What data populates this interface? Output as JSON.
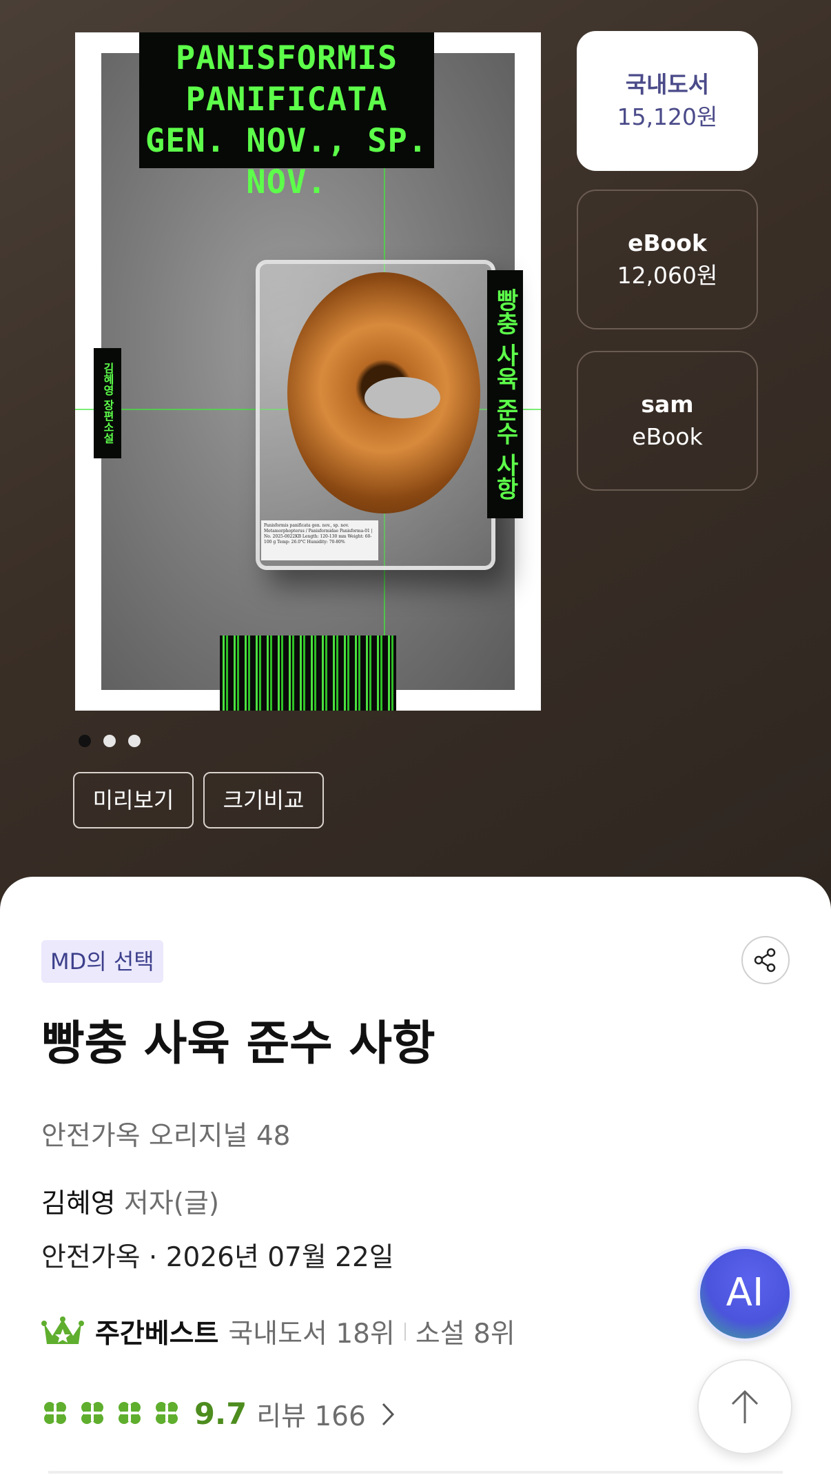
{
  "cover": {
    "title_text": "PANISFORMIS PANIFICATA GEN. NOV., SP. NOV.",
    "side_title": "빵충 사육 준수 사항",
    "side_author": "김혜영 장편소설",
    "label_text": "Panisformis panificata gen. nov., sp. nov. Metamorphopterus / Panisformidae Panisforma-01 | No. 2025-0022KB Length: 120-130 mm Weight: 60-100 g Temp: 26.0°C Humidity: 70-80%"
  },
  "formats": [
    {
      "name": "국내도서",
      "price": "15,120원",
      "selected": true
    },
    {
      "name": "eBook",
      "price": "12,060원",
      "selected": false
    },
    {
      "name": "sam",
      "price": "eBook",
      "selected": false
    }
  ],
  "carousel": {
    "count": 3,
    "active": 0
  },
  "buttons": {
    "preview": "미리보기",
    "size_compare": "크기비교"
  },
  "badge": "MD의 선택",
  "book": {
    "title": "빵충 사육 준수 사항",
    "series": "안전가옥 오리지널 48",
    "author_name": "김혜영",
    "author_role": "저자(글)",
    "publisher_date": "안전가옥 · 2026년 07월 22일"
  },
  "bestseller": {
    "label": "주간베스트",
    "rank_domestic": "국내도서 18위",
    "rank_novel": "소설 8위"
  },
  "rating": {
    "score": "9.7",
    "reviews": "리뷰 166",
    "clover_count": 4
  },
  "floating": {
    "ai_label": "AI"
  },
  "colors": {
    "accent": "#4b4b8a",
    "rating_green": "#4d8c1e",
    "hero_bg": "#3b3029"
  }
}
